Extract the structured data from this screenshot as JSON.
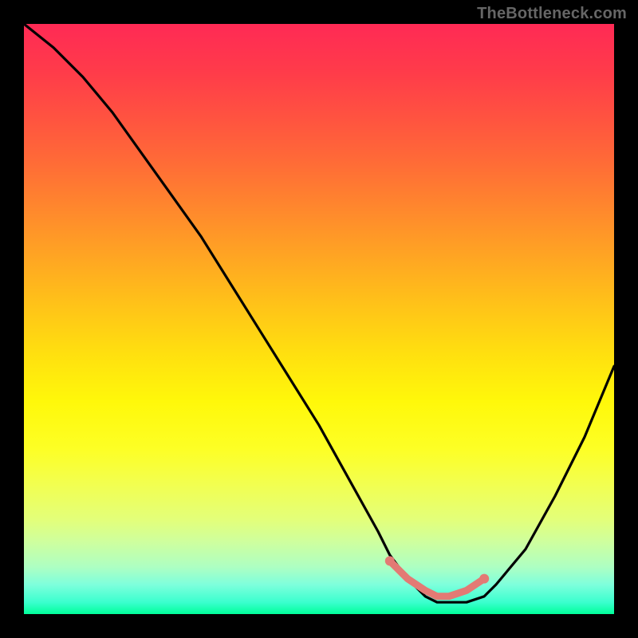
{
  "watermark": "TheBottleneck.com",
  "chart_data": {
    "type": "line",
    "title": "",
    "xlabel": "",
    "ylabel": "",
    "xlim": [
      0,
      100
    ],
    "ylim": [
      0,
      100
    ],
    "series": [
      {
        "name": "bottleneck-curve",
        "x": [
          0,
          5,
          10,
          15,
          20,
          25,
          30,
          35,
          40,
          45,
          50,
          55,
          60,
          62,
          65,
          68,
          70,
          72,
          75,
          78,
          80,
          85,
          90,
          95,
          100
        ],
        "y": [
          100,
          96,
          91,
          85,
          78,
          71,
          64,
          56,
          48,
          40,
          32,
          23,
          14,
          10,
          6,
          3,
          2,
          2,
          2,
          3,
          5,
          11,
          20,
          30,
          42
        ]
      },
      {
        "name": "optimal-band",
        "x": [
          62,
          65,
          68,
          70,
          72,
          75,
          78
        ],
        "y": [
          9,
          6,
          4,
          3,
          3,
          4,
          6
        ]
      }
    ],
    "colors": {
      "curve": "#000000",
      "band": "#e37a74",
      "band_end": "#e37a74"
    }
  }
}
